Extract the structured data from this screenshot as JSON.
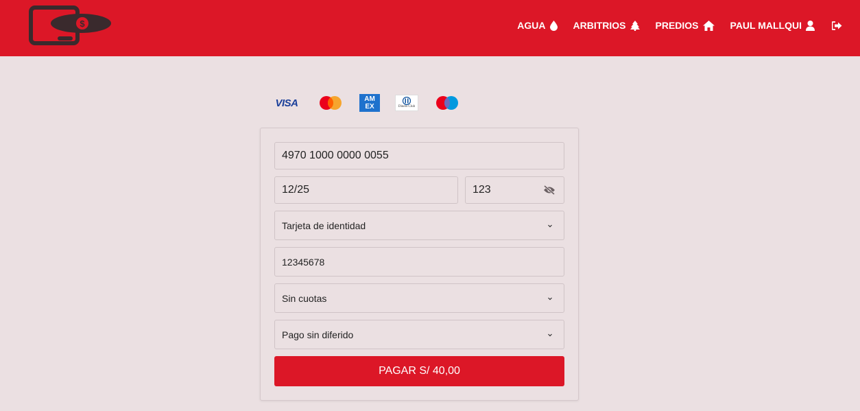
{
  "nav": {
    "agua": "AGUA",
    "arbitrios": "ARBITRIOS",
    "predios": "PREDIOS",
    "user": "PAUL MALLQUI"
  },
  "brands": {
    "visa": "VISA",
    "amex": "AM EX",
    "diners": "Diners Club"
  },
  "form": {
    "card_number": "4970 1000 0000 0055",
    "expiry": "12/25",
    "cvv": "123",
    "doc_type": "Tarjeta de identidad",
    "doc_number": "12345678",
    "installments": "Sin cuotas",
    "deferral": "Pago sin diferido",
    "pay_label": "PAGAR S/ 40,00"
  },
  "colors": {
    "brand_red": "#dc1727",
    "page_bg": "#ebe0e2"
  },
  "icons": {
    "agua": "water-drop-icon",
    "arbitrios": "tree-icon",
    "predios": "home-icon",
    "user": "user-icon",
    "logout": "logout-icon",
    "cvv": "eye-slash-icon",
    "select": "chevron-down-icon"
  }
}
